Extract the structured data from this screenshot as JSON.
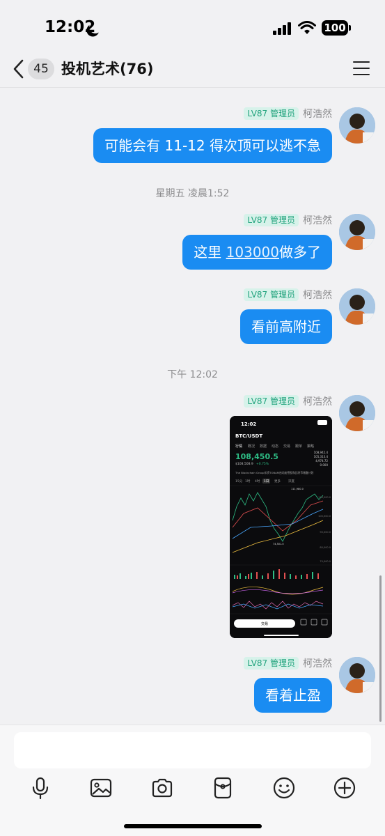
{
  "status_bar": {
    "time": "12:02",
    "battery": "100"
  },
  "header": {
    "unread_count": "45",
    "title": "投机艺术(76)"
  },
  "messages": [
    {
      "type": "text",
      "level": "LV87 管理员",
      "sender": "柯浩然",
      "text": "可能会有 11-12 得次顶可以逃不急"
    },
    {
      "type": "time",
      "text": "星期五 凌晨1:52"
    },
    {
      "type": "text",
      "level": "LV87 管理员",
      "sender": "柯浩然",
      "text_before": "这里 ",
      "link": "103000",
      "text_after": "做多了"
    },
    {
      "type": "text",
      "level": "LV87 管理员",
      "sender": "柯浩然",
      "text": "看前高附近"
    },
    {
      "type": "time",
      "text": "下午 12:02"
    },
    {
      "type": "image",
      "level": "LV87 管理员",
      "sender": "柯浩然"
    },
    {
      "type": "text",
      "level": "LV87 管理员",
      "sender": "柯浩然",
      "text": "看着止盈"
    }
  ],
  "screenshot": {
    "time": "12:02",
    "pair": "BTC/USDT",
    "tabs": [
      "行情",
      "概况",
      "数据",
      "动态",
      "交易",
      "跟单",
      "策略"
    ],
    "price": "108,450.5",
    "sub_price": "$108,508.9",
    "change": "+0.75%",
    "stats": [
      "108,942.4",
      "105,313.4",
      "4,974.72",
      "0.000"
    ],
    "news": "The Blockchain Group斥资TOBAM启动加密股和比特币储备计划",
    "intervals": [
      "15分",
      "1时",
      "4时",
      "1日",
      "更多",
      "深度"
    ],
    "axis_prices": [
      "110,000.0",
      "100,000.0",
      "90,000.0",
      "80,000.0",
      "70,000.0"
    ],
    "high_label": "111,980.0",
    "low_label": "74,501.0",
    "trade_button": "交易"
  },
  "composer": {
    "placeholder": ""
  },
  "colors": {
    "bubble": "#1a8cf2",
    "badge_bg": "#d7f2ea",
    "badge_text": "#21a37d",
    "up": "#2ebd85"
  }
}
